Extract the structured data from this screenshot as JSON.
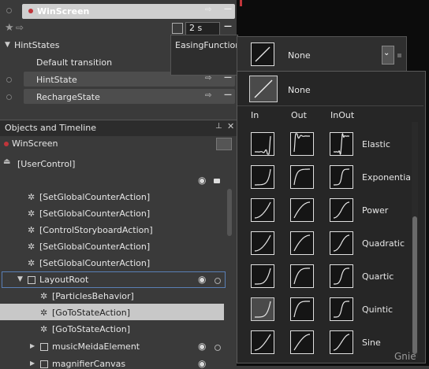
{
  "states_panel": {
    "winscreen_label": "WinScreen",
    "duration_value": "2 s",
    "hintstates_label": "HintStates",
    "default_transition_label": "Default transition",
    "states": [
      "HintState",
      "RechargeState"
    ],
    "easing_function_label": "EasingFunction"
  },
  "objects_panel": {
    "title": "Objects and Timeline",
    "scope_label": "WinScreen",
    "root_label": "[UserControl]",
    "items": [
      "[SetGlobalCounterAction]",
      "[SetGlobalCounterAction]",
      "[ControlStoryboardAction]",
      "[SetGlobalCounterAction]",
      "[SetGlobalCounterAction]",
      "LayoutRoot",
      "[ParticlesBehavior]",
      "[GoToStateAction]",
      "[GoToStateAction]",
      "musicMeidaElement",
      "magnifierCanvas"
    ]
  },
  "easing": {
    "selected_label": "None",
    "preview_label": "None",
    "col_in": "In",
    "col_out": "Out",
    "col_inout": "InOut",
    "functions": [
      "Elastic",
      "Exponential",
      "Power",
      "Quadratic",
      "Quartic",
      "Quintic",
      "Sine"
    ],
    "selected_tile": "Quintic-In"
  },
  "watermark": "Gnie",
  "colors": {
    "accent_red": "#c0353a",
    "selected_row": "#c8c8c8",
    "panel_bg": "#3a3a3a",
    "dark_bg": "#151515"
  }
}
